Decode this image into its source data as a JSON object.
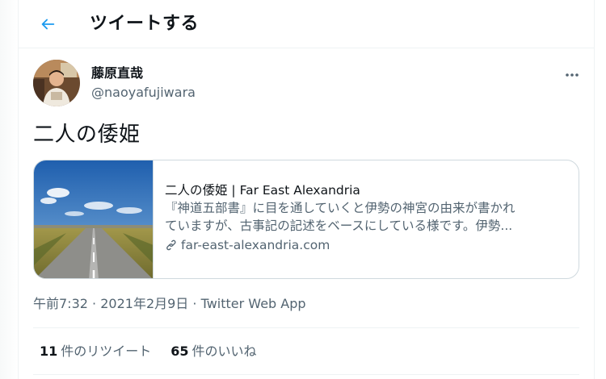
{
  "header": {
    "title": "ツイートする",
    "back_icon": "arrow-left-icon",
    "accent_color": "#1d9bf0"
  },
  "author": {
    "name": "藤原直哉",
    "handle": "@naoyafujiwara"
  },
  "tweet": {
    "text": "二人の倭姫"
  },
  "card": {
    "title": "二人の倭姫 | Far East Alexandria",
    "description_line1": "『神道五部書』に目を通していくと伊勢の神宮の由来が書かれ",
    "description_line2": "ていますが、古事記の記述をベースにしている様です。伊勢...",
    "domain": "far-east-alexandria.com",
    "link_icon": "link-icon",
    "thumbnail": "road-landscape-image"
  },
  "meta": {
    "time": "午前7:32",
    "separator": "·",
    "date": "2021年2月9日",
    "source": "Twitter Web App"
  },
  "stats": {
    "retweets_count": "11",
    "retweets_label": "件のリツイート",
    "likes_count": "65",
    "likes_label": "件のいいね"
  }
}
